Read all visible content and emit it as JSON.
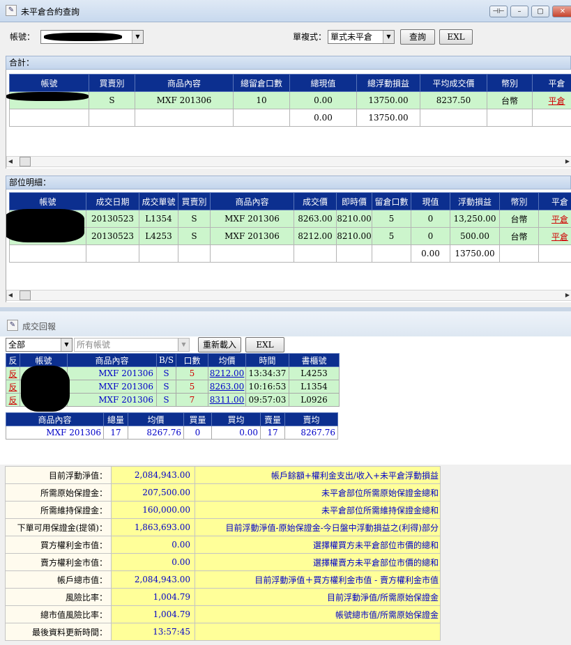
{
  "window": {
    "title": "未平倉合約查詢",
    "controls": [
      "⊣⊢",
      "–",
      "▢",
      "✕"
    ]
  },
  "filters": {
    "account_label": "帳號：",
    "account_value": "",
    "mode_label": "單複式：",
    "mode_value": "單式未平倉",
    "query_button": "查詢",
    "excel_button": "EXL"
  },
  "totals": {
    "section_title": "合計：",
    "columns": [
      "帳號",
      "買賣別",
      "商品內容",
      "總留倉口數",
      "總現值",
      "總浮動損益",
      "平均成交價",
      "幣別",
      "平倉"
    ],
    "rows": [
      [
        "",
        "S",
        "MXF 201306",
        "10",
        "0.00",
        "13750.00",
        "8237.50",
        "台幣",
        "平倉"
      ],
      [
        "",
        "",
        "",
        "",
        "0.00",
        "13750.00",
        "",
        "",
        ""
      ]
    ]
  },
  "details": {
    "section_title": "部位明細：",
    "columns": [
      "帳號",
      "成交日期",
      "成交單號",
      "買賣別",
      "商品內容",
      "成交價",
      "即時價",
      "留倉口數",
      "現值",
      "浮動損益",
      "幣別",
      "平倉"
    ],
    "rows": [
      [
        "",
        "20130523",
        "L1354",
        "S",
        "MXF 201306",
        "8263.00",
        "8210.00",
        "5",
        "0",
        "13,250.00",
        "台幣",
        "平倉"
      ],
      [
        "",
        "20130523",
        "L4253",
        "S",
        "MXF 201306",
        "8212.00",
        "8210.00",
        "5",
        "0",
        "500.00",
        "台幣",
        "平倉"
      ],
      [
        "",
        "",
        "",
        "",
        "",
        "",
        "",
        "",
        "0.00",
        "13750.00",
        "",
        ""
      ]
    ]
  },
  "fills": {
    "title": "成交回報",
    "filter_value": "全部",
    "account_value": "所有帳號",
    "reload_button": "重新載入",
    "excel_button": "EXL",
    "columns": [
      "反",
      "帳號",
      "商品內容",
      "B/S",
      "口數",
      "均價",
      "時間",
      "書櫃號"
    ],
    "rows": [
      [
        "反",
        "",
        "MXF 201306",
        "S",
        "5",
        "8212.00",
        "13:34:37",
        "L4253"
      ],
      [
        "反",
        "",
        "MXF 201306",
        "S",
        "5",
        "8263.00",
        "10:16:53",
        "L1354"
      ],
      [
        "反",
        "",
        "MXF 201306",
        "S",
        "7",
        "8311.00",
        "09:57:03",
        "L0926"
      ]
    ],
    "summary_columns": [
      "商品內容",
      "總量",
      "均價",
      "買量",
      "買均",
      "賣量",
      "賣均"
    ],
    "summary_row": [
      "MXF 201306",
      "17",
      "8267.76",
      "0",
      "0.00",
      "17",
      "8267.76"
    ]
  },
  "margin": {
    "rows": [
      {
        "label": "目前浮動淨值：",
        "value": "2,084,943.00",
        "desc": "帳戶餘額+權利金支出/收入+未平倉浮動損益"
      },
      {
        "label": "所需原始保證金：",
        "value": "207,500.00",
        "desc": "未平倉部位所需原始保證金總和"
      },
      {
        "label": "所需維持保證金：",
        "value": "160,000.00",
        "desc": "未平倉部位所需維持保證金總和"
      },
      {
        "label": "下單可用保證金(提領)：",
        "value": "1,863,693.00",
        "desc": "目前浮動淨值-原始保證金-今日盤中浮動損益之(利得)部分"
      },
      {
        "label": "買方權利金市值：",
        "value": "0.00",
        "desc": "選擇權買方未平倉部位市價的總和"
      },
      {
        "label": "賣方權利金市值：",
        "value": "0.00",
        "desc": "選擇權賣方未平倉部位市價的總和"
      },
      {
        "label": "帳戶總市值：",
        "value": "2,084,943.00",
        "desc": "目前浮動淨值＋買方權利金市值 - 賣方權利金市值"
      },
      {
        "label": "風險比率：",
        "value": "1,004.79",
        "desc": "目前浮動淨值/所需原始保證金"
      },
      {
        "label": "總市值風險比率：",
        "value": "1,004.79",
        "desc": "帳號總市值/所需原始保證金"
      },
      {
        "label": "最後資料更新時間：",
        "value": "13:57:45",
        "desc": ""
      }
    ]
  }
}
